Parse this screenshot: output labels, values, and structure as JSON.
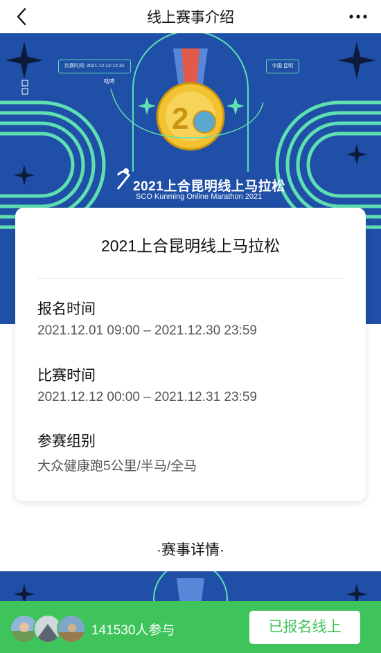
{
  "nav": {
    "title": "线上赛事介绍",
    "back_icon": "chevron-left-icon",
    "more_icon": "more-horizontal-icon"
  },
  "banner": {
    "title": "2021上合昆明线上马拉松",
    "subtitle": "SCO Kunming Online Marathon 2021",
    "pill_left": "比赛时间: 2021.12.12-12.31",
    "pill_right": "中国 昆明",
    "brand": "咕咚",
    "colors": {
      "background": "#1f4fa6",
      "track": "#5fe0b3",
      "medal": "#f2c230"
    }
  },
  "card": {
    "name": "2021上合昆明线上马拉松",
    "sections": [
      {
        "label": "报名时间",
        "value": "2021.12.01 09:00 – 2021.12.30 23:59"
      },
      {
        "label": "比赛时间",
        "value": "2021.12.12 00:00 – 2021.12.31 23:59"
      },
      {
        "label": "参赛组别",
        "value": "大众健康跑5公里/半马/全马"
      }
    ]
  },
  "details_heading": "·赛事详情·",
  "footer": {
    "participants": "141530人参与",
    "signup_label": "已报名线上",
    "accent": "#3ec45a"
  }
}
